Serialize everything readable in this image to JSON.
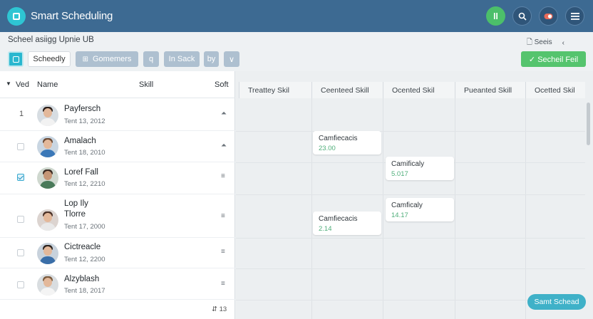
{
  "app": {
    "title": "Smart Scheduling"
  },
  "header": {
    "btn_green_label": "ll"
  },
  "subbar": {
    "title": "Scheel asiigg Upnie UB",
    "search_label": "Seeis",
    "back_label": "‹"
  },
  "toolbar": {
    "schedule_label": "Scheedly",
    "components_label": "Gomemers",
    "q_label": "q",
    "in_sack_label": "In Sack",
    "by_label": "by",
    "dropdown_label": "∨",
    "schedule_field_label": "✓ Secheil Feil"
  },
  "table": {
    "col_var": "Ved",
    "col_name": "Name",
    "col_skill": "Skill",
    "col_sort": "Soft",
    "footer_count": "⇵ 13"
  },
  "people": [
    {
      "num": "1",
      "name": "Payfersch",
      "date": "Tent 13, 2012",
      "icon": "⏶",
      "checked": false,
      "show_num": true
    },
    {
      "num": "",
      "name": "Amalach",
      "date": "Tent 18, 2010",
      "icon": "⏶",
      "checked": false,
      "show_num": false
    },
    {
      "num": "",
      "name": "Loref Fall",
      "date": "Tent 12, 2210",
      "icon": "≡",
      "checked": true,
      "show_num": false
    },
    {
      "num": "",
      "name": "Lop Ily",
      "name2": "Tlorre",
      "date": "Tent 17, 2000",
      "icon": "≡",
      "checked": false,
      "show_num": false
    },
    {
      "num": "",
      "name": "Cictreacle",
      "date": "Tent 12, 2200",
      "icon": "≡",
      "checked": false,
      "show_num": false
    },
    {
      "num": "",
      "name": "Alzyblash",
      "date": "Tent 18, 2017",
      "icon": "≡",
      "checked": false,
      "show_num": false
    }
  ],
  "grid": {
    "columns": [
      "Treattey Skil",
      "Ceenteed Skill",
      "Ocented Skil",
      "Pueanted Skill",
      "Ocetted Skil"
    ],
    "cards": [
      {
        "title": "Camfiecacis",
        "number": "23.00"
      },
      {
        "title": "Camificaly",
        "number": "5.017"
      },
      {
        "title": "Camficaly",
        "number": "14.17"
      },
      {
        "title": "Camfiecacis",
        "number": "2.14"
      }
    ],
    "smart_button": "Samt Schead"
  },
  "colors": {
    "header": "#3d6a92",
    "accent": "#2ab7cf",
    "success": "#55c46e"
  }
}
